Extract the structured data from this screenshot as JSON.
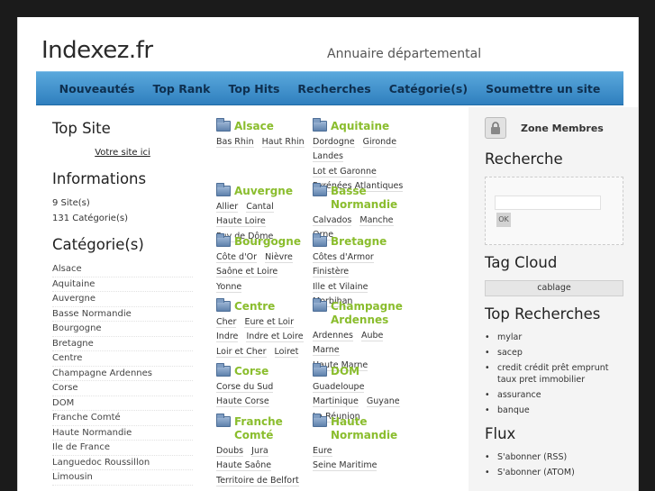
{
  "header": {
    "logo": "Indexez.fr",
    "tagline": "Annuaire départemental"
  },
  "nav": [
    "Nouveautés",
    "Top Rank",
    "Top Hits",
    "Recherches",
    "Catégorie(s)",
    "Soumettre un site"
  ],
  "left": {
    "top_site_title": "Top Site",
    "votre_site": "Votre site ici",
    "info_title": "Informations",
    "sites": "9 Site(s)",
    "cats": "131 Catégorie(s)",
    "categories_title": "Catégorie(s)",
    "categories": [
      "Alsace",
      "Aquitaine",
      "Auvergne",
      "Basse Normandie",
      "Bourgogne",
      "Bretagne",
      "Centre",
      "Champagne Ardennes",
      "Corse",
      "DOM",
      "Franche Comté",
      "Haute Normandie",
      "Ile de France",
      "Languedoc Roussillon",
      "Limousin"
    ]
  },
  "regions": [
    {
      "name": "Alsace",
      "deps": [
        "Bas Rhin",
        "Haut Rhin"
      ]
    },
    {
      "name": "Aquitaine",
      "deps": [
        "Dordogne",
        "Gironde",
        "Landes",
        "Lot et Garonne",
        "Pyrénées Atlantiques"
      ]
    },
    {
      "name": "Auvergne",
      "deps": [
        "Allier",
        "Cantal",
        "Haute Loire",
        "Puy de Dôme"
      ]
    },
    {
      "name": "Basse Normandie",
      "deps": [
        "Calvados",
        "Manche",
        "Orne"
      ]
    },
    {
      "name": "Bourgogne",
      "deps": [
        "Côte d'Or",
        "Nièvre",
        "Saône et Loire",
        "Yonne"
      ]
    },
    {
      "name": "Bretagne",
      "deps": [
        "Côtes d'Armor",
        "Finistère",
        "Ille et Vilaine",
        "Morbihan"
      ]
    },
    {
      "name": "Centre",
      "deps": [
        "Cher",
        "Eure et Loir",
        "Indre",
        "Indre et Loire",
        "Loir et Cher",
        "Loiret"
      ]
    },
    {
      "name": "Champagne Ardennes",
      "deps": [
        "Ardennes",
        "Aube",
        "Marne",
        "Haute Marne"
      ]
    },
    {
      "name": "Corse",
      "deps": [
        "Corse du Sud",
        "Haute Corse"
      ]
    },
    {
      "name": "DOM",
      "deps": [
        "Guadeloupe",
        "Martinique",
        "Guyane",
        "La Réunion"
      ]
    },
    {
      "name": "Franche Comté",
      "deps": [
        "Doubs",
        "Jura",
        "Haute Saône",
        "Territoire de Belfort"
      ]
    },
    {
      "name": "Haute Normandie",
      "deps": [
        "Eure",
        "Seine Maritime"
      ]
    }
  ],
  "right": {
    "zone": "Zone Membres",
    "recherche_title": "Recherche",
    "ok": "OK",
    "tag_title": "Tag Cloud",
    "tag": "cablage",
    "top_rech_title": "Top Recherches",
    "top_rech": [
      "mylar",
      "sacep",
      "credit crédit prêt emprunt taux pret immobilier",
      "assurance",
      "banque"
    ],
    "flux_title": "Flux",
    "flux": [
      "S'abonner (RSS)",
      "S'abonner (ATOM)"
    ]
  }
}
